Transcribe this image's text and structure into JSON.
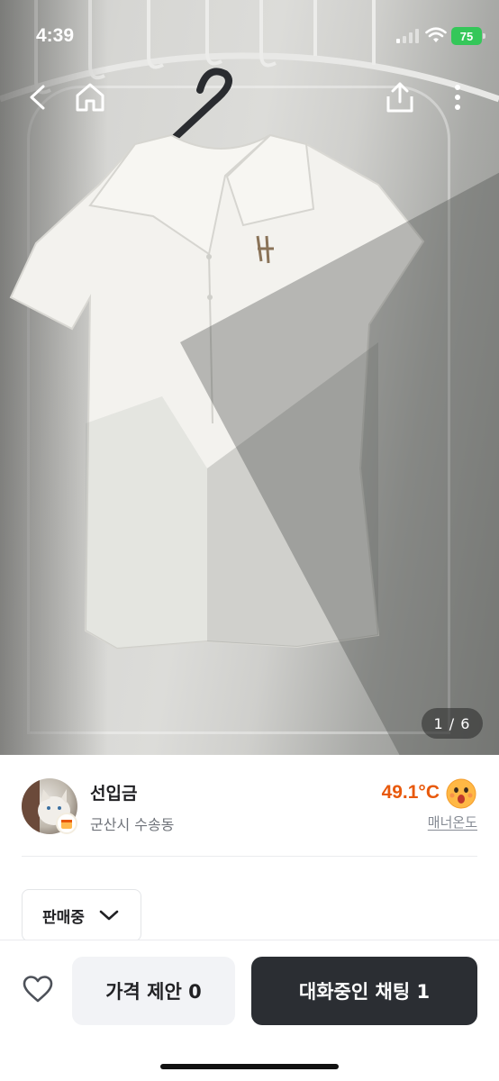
{
  "status_bar": {
    "time": "4:39",
    "battery": "75"
  },
  "nav": {
    "icons": [
      "back-arrow-icon",
      "home-icon",
      "share-icon",
      "more-vertical-icon"
    ]
  },
  "gallery": {
    "page_indicator": "1 / 6",
    "current": 1,
    "total": 6
  },
  "seller": {
    "name": "선입금",
    "location": "군산시 수송동",
    "temperature": "49.1°C",
    "manner_label": "매너온도"
  },
  "sale_status": {
    "label": "판매중"
  },
  "actions": {
    "price_offer": "가격 제안 0",
    "chatting": "대화중인 채팅 1"
  },
  "colors": {
    "temperature": "#e8590c",
    "chat_button": "#2b2e33",
    "offer_button": "#f2f3f6",
    "battery": "#34c759"
  }
}
